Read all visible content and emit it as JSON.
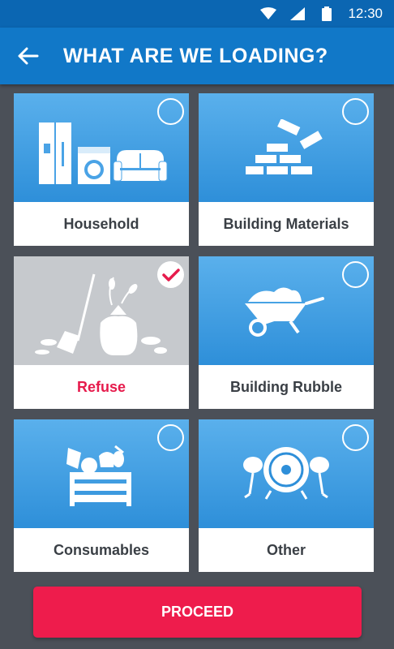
{
  "status_bar": {
    "time": "12:30",
    "icons": [
      "wifi-icon",
      "signal-icon",
      "battery-icon"
    ]
  },
  "header": {
    "title": "WHAT ARE WE LOADING?",
    "back_icon": "arrow-left-icon"
  },
  "categories": [
    {
      "label": "Household",
      "icon": "household-appliances-icon",
      "selected": false
    },
    {
      "label": "Building Materials",
      "icon": "bricks-icon",
      "selected": false
    },
    {
      "label": "Refuse",
      "icon": "garden-waste-bag-icon",
      "selected": true
    },
    {
      "label": "Building Rubble",
      "icon": "wheelbarrow-icon",
      "selected": false
    },
    {
      "label": "Consumables",
      "icon": "produce-crate-icon",
      "selected": false
    },
    {
      "label": "Other",
      "icon": "drum-kit-icon",
      "selected": false
    }
  ],
  "footer": {
    "proceed_label": "PROCEED"
  },
  "colors": {
    "primary": "#1178c8",
    "accent": "#ee1c4c",
    "background": "#4b5058"
  }
}
